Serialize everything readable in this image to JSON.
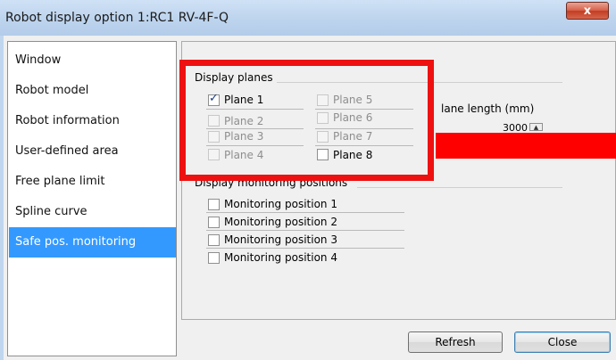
{
  "window": {
    "title": "Robot display option 1:RC1 RV-4F-Q",
    "close_glyph": "x"
  },
  "sidebar": {
    "items": [
      {
        "label": "Window",
        "selected": false
      },
      {
        "label": "Robot model",
        "selected": false
      },
      {
        "label": "Robot information",
        "selected": false
      },
      {
        "label": "User-defined area",
        "selected": false
      },
      {
        "label": "Free plane limit",
        "selected": false
      },
      {
        "label": "Spline curve",
        "selected": false
      },
      {
        "label": "Safe pos. monitoring",
        "selected": true
      }
    ]
  },
  "display_planes": {
    "label": "Display planes",
    "planes": [
      {
        "label": "Plane 1",
        "checked": true,
        "enabled": true
      },
      {
        "label": "Plane 2",
        "checked": false,
        "enabled": false
      },
      {
        "label": "Plane 3",
        "checked": false,
        "enabled": false
      },
      {
        "label": "Plane 4",
        "checked": false,
        "enabled": false
      },
      {
        "label": "Plane 5",
        "checked": false,
        "enabled": false
      },
      {
        "label": "Plane 6",
        "checked": false,
        "enabled": false
      },
      {
        "label": "Plane 7",
        "checked": false,
        "enabled": false
      },
      {
        "label": "Plane 8",
        "checked": false,
        "enabled": true
      }
    ]
  },
  "plane_length": {
    "label": "lane length (mm)",
    "value": "3000"
  },
  "monitoring": {
    "label": "Display monitoring positions",
    "positions": [
      {
        "label": "Monitoring position 1",
        "checked": false
      },
      {
        "label": "Monitoring position 2",
        "checked": false
      },
      {
        "label": "Monitoring position 3",
        "checked": false
      },
      {
        "label": "Monitoring position 4",
        "checked": false
      }
    ]
  },
  "buttons": {
    "refresh": "Refresh",
    "close": "Close"
  },
  "colors": {
    "highlight_red": "#ee1111",
    "selection_blue": "#3399ff"
  }
}
